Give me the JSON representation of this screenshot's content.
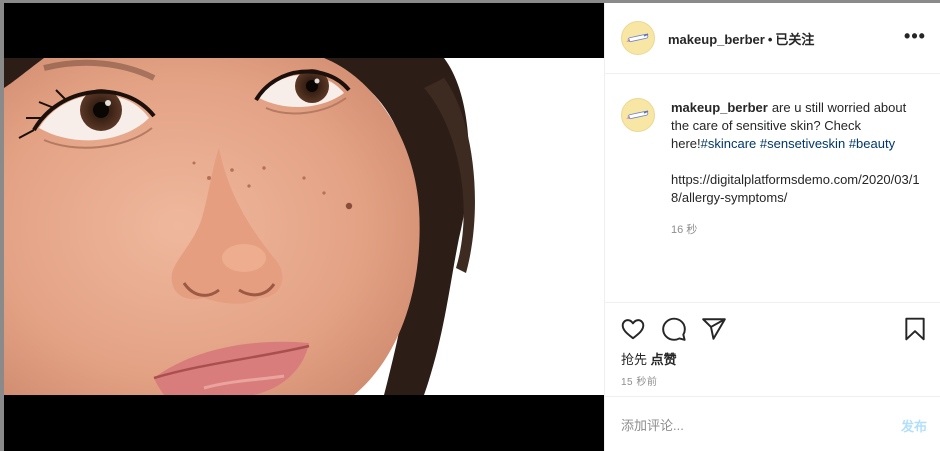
{
  "post": {
    "image_alt": "close-up of a woman's face looking up",
    "username": "makeup_berber",
    "separator": "•",
    "follow_status": "已关注",
    "more_label": "•••"
  },
  "caption": {
    "username": "makeup_berber",
    "text": "are u still worried about the care of sensitive skin? Check here!",
    "hashtags": [
      "#skincare",
      "#sensetiveskin",
      "#beauty"
    ],
    "link": "https://digitalplatformsdemo.com/2020/03/18/allergy-symptoms/",
    "time_ago": "16 秒"
  },
  "actions": {
    "likes_prefix": "抢先",
    "likes_action": "点赞",
    "post_time": "15 秒前"
  },
  "comment": {
    "placeholder": "添加评论...",
    "post_label": "发布"
  },
  "icons": {
    "like": "heart-icon",
    "comment": "comment-bubble-icon",
    "share": "paper-plane-icon",
    "bookmark": "bookmark-icon",
    "more": "more-horizontal-icon"
  },
  "colors": {
    "hashtag": "#00376b",
    "post_button_disabled": "#b2dffc",
    "avatar_bg": "#f8e6a4",
    "meta_text": "#8e8e8e"
  }
}
